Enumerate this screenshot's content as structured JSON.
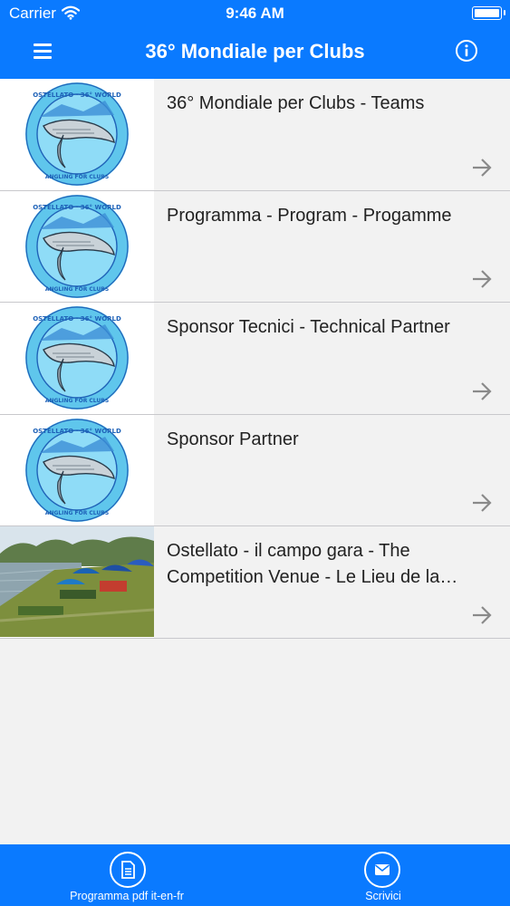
{
  "status_bar": {
    "carrier": "Carrier",
    "time": "9:46 AM"
  },
  "navbar": {
    "title": "36° Mondiale per Clubs",
    "menu_icon": "hamburger-menu-icon",
    "info_icon": "info-icon"
  },
  "list": {
    "items": [
      {
        "label": "36° Mondiale per Clubs - Teams",
        "thumbnail": "championship-logo"
      },
      {
        "label": "Programma - Program - Progamme",
        "thumbnail": "championship-logo"
      },
      {
        "label": "Sponsor Tecnici - Technical Partner",
        "thumbnail": "championship-logo"
      },
      {
        "label": "Sponsor Partner",
        "thumbnail": "championship-logo"
      },
      {
        "label": "Ostellato - il campo gara - The Competition Venue - Le Lieu de la…",
        "thumbnail": "venue-photo"
      }
    ]
  },
  "tab_bar": {
    "tabs": [
      {
        "label": "Programma pdf it-en-fr",
        "icon": "document-icon"
      },
      {
        "label": "Scrivici",
        "icon": "envelope-icon"
      }
    ]
  },
  "colors": {
    "accent": "#0a7aff",
    "background": "#f2f2f2",
    "separator": "#c8c8cc"
  }
}
